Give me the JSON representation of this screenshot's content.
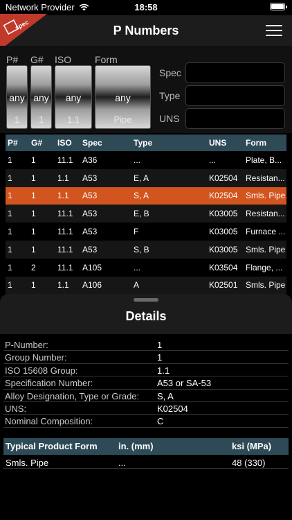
{
  "status_bar": {
    "carrier": "Network Provider",
    "time": "18:58"
  },
  "header": {
    "title": "P Numbers",
    "logo_text": "spec"
  },
  "filters": {
    "pickers": [
      {
        "label": "P#",
        "value": "any",
        "next": "1"
      },
      {
        "label": "G#",
        "value": "any",
        "next": "1"
      },
      {
        "label": "ISO",
        "value": "any",
        "next": "1.1"
      },
      {
        "label": "Form",
        "value": "any",
        "next": "Pipe"
      }
    ],
    "fields": [
      {
        "label": "Spec",
        "value": ""
      },
      {
        "label": "Type",
        "value": ""
      },
      {
        "label": "UNS",
        "value": ""
      }
    ]
  },
  "table": {
    "columns": [
      "P#",
      "G#",
      "ISO",
      "Spec",
      "Type",
      "UNS",
      "Form"
    ],
    "selected_row": 2,
    "rows": [
      [
        "1",
        "1",
        "11.1",
        "A36",
        "...",
        "...",
        "Plate, B..."
      ],
      [
        "1",
        "1",
        "1.1",
        "A53",
        "E, A",
        "K02504",
        "Resistan..."
      ],
      [
        "1",
        "1",
        "1.1",
        "A53",
        "S, A",
        "K02504",
        "Smls. Pipe"
      ],
      [
        "1",
        "1",
        "11.1",
        "A53",
        "E, B",
        "K03005",
        "Resistan..."
      ],
      [
        "1",
        "1",
        "11.1",
        "A53",
        "F",
        "K03005",
        "Furnace ..."
      ],
      [
        "1",
        "1",
        "11.1",
        "A53",
        "S, B",
        "K03005",
        "Smls. Pipe"
      ],
      [
        "1",
        "2",
        "11.1",
        "A105",
        "...",
        "K03504",
        "Flange, ..."
      ],
      [
        "1",
        "1",
        "1.1",
        "A106",
        "A",
        "K02501",
        "Smls. Pipe"
      ]
    ]
  },
  "details": {
    "title": "Details",
    "rows": [
      {
        "key": "P-Number:",
        "value": "1"
      },
      {
        "key": "Group Number:",
        "value": "1"
      },
      {
        "key": "ISO 15608 Group:",
        "value": "1.1"
      },
      {
        "key": "Specification Number:",
        "value": "A53 or SA-53"
      },
      {
        "key": "Alloy Designation, Type or Grade:",
        "value": "S, A"
      },
      {
        "key": "UNS:",
        "value": "K02504"
      },
      {
        "key": "Nominal Composition:",
        "value": "C"
      }
    ]
  },
  "product_forms": {
    "columns": [
      "Typical Product Form",
      "in. (mm)",
      "ksi (MPa)"
    ],
    "rows": [
      [
        "Smls. Pipe",
        "...",
        "48 (330)"
      ]
    ]
  },
  "colors": {
    "header_bg": "#2e4a57",
    "selected_row": "#d2541e",
    "logo_red": "#c0392b"
  }
}
